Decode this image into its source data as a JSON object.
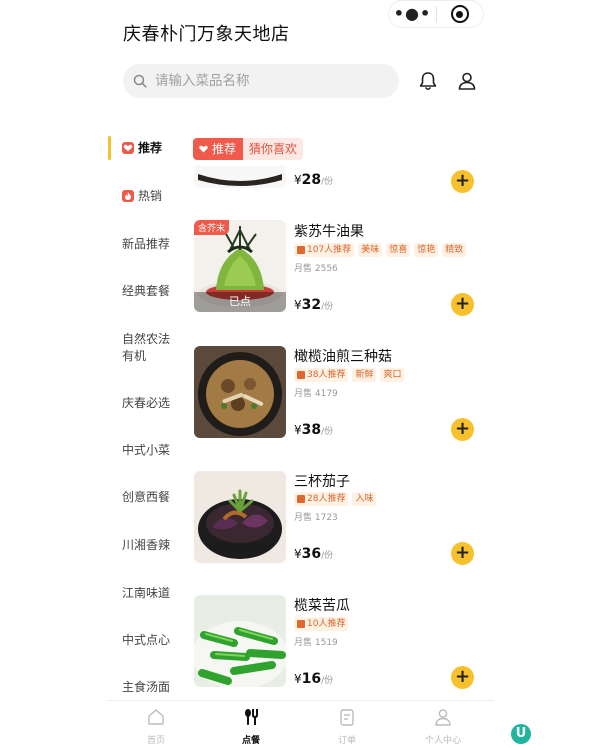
{
  "header": {
    "store_name": "庆春朴门万象天地店",
    "search_placeholder": "请输入菜品名称"
  },
  "section": {
    "badge": "推荐",
    "subtitle": "猜你喜欢"
  },
  "sidebar": {
    "items": [
      {
        "label": "推荐",
        "active": true,
        "icon": "heart-icon"
      },
      {
        "label": "热销",
        "active": false,
        "icon": "flame-icon"
      },
      {
        "label": "新品推荐"
      },
      {
        "label": "经典套餐"
      },
      {
        "label": "自然农法有机"
      },
      {
        "label": "庆春必选"
      },
      {
        "label": "中式小菜"
      },
      {
        "label": "创意西餐"
      },
      {
        "label": "川湘香辣"
      },
      {
        "label": "江南味道"
      },
      {
        "label": "中式点心"
      },
      {
        "label": "主食汤面"
      }
    ]
  },
  "dishes": [
    {
      "price": "28",
      "currency": "¥",
      "unit": "/份"
    },
    {
      "name": "紫苏牛油果",
      "corner_tag": "含芥末",
      "overlay": "已点",
      "tags": [
        "107人推荐",
        "美味",
        "惊喜",
        "惊艳",
        "精致"
      ],
      "sales": "月售 2556",
      "price": "32",
      "currency": "¥",
      "unit": "/份"
    },
    {
      "name": "橄榄油煎三种菇",
      "tags": [
        "38人推荐",
        "新鲜",
        "爽口"
      ],
      "sales": "月售 4179",
      "price": "38",
      "currency": "¥",
      "unit": "/份"
    },
    {
      "name": "三杯茄子",
      "tags": [
        "28人推荐",
        "入味"
      ],
      "sales": "月售 1723",
      "price": "36",
      "currency": "¥",
      "unit": "/份"
    },
    {
      "name": "榄菜苦瓜",
      "tags": [
        "10人推荐"
      ],
      "sales": "月售 1519",
      "price": "16",
      "currency": "¥",
      "unit": "/份"
    }
  ],
  "bottom_nav": [
    {
      "label": "首页",
      "icon": "home-icon"
    },
    {
      "label": "点餐",
      "icon": "cutlery-icon",
      "active": true
    },
    {
      "label": "订单",
      "icon": "order-icon"
    },
    {
      "label": "个人中心",
      "icon": "user-icon"
    }
  ],
  "watermark": "U",
  "colors": {
    "accent": "#f6c12c",
    "brand_red": "#ef5a4a",
    "tag_text": "#d9682f"
  }
}
